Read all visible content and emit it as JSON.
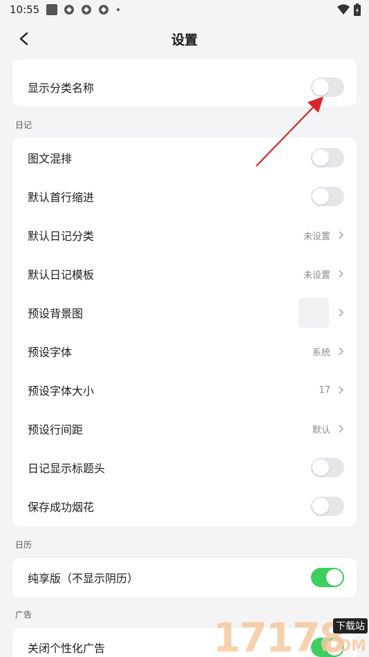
{
  "status_bar": {
    "time": "10:55"
  },
  "header": {
    "title": "设置"
  },
  "top_card": {
    "items": [
      {
        "label": "显示分类名称",
        "toggle": false
      }
    ]
  },
  "sections": [
    {
      "title": "日记",
      "items": [
        {
          "label": "图文混排",
          "toggle": false
        },
        {
          "label": "默认首行缩进",
          "toggle": false
        },
        {
          "label": "默认日记分类",
          "value": "未设置"
        },
        {
          "label": "默认日记模板",
          "value": "未设置"
        },
        {
          "label": "预设背景图"
        },
        {
          "label": "预设字体",
          "value": "系统"
        },
        {
          "label": "预设字体大小",
          "value": "17"
        },
        {
          "label": "预设行间距",
          "value": "默认"
        },
        {
          "label": "日记显示标题头",
          "toggle": false
        },
        {
          "label": "保存成功烟花",
          "toggle": false
        }
      ]
    },
    {
      "title": "日历",
      "items": [
        {
          "label": "纯享版（不显示阴历）",
          "toggle": true
        }
      ]
    },
    {
      "title": "广告",
      "items": [
        {
          "label": "关闭个性化广告",
          "toggle": true
        }
      ]
    }
  ],
  "watermark": {
    "number": "17178",
    "site": "下载站",
    "suffix": ".COM"
  },
  "colors": {
    "toggle_on": "#3ecf61",
    "toggle_off": "#e6e6ea",
    "arrow": "#d9242b"
  }
}
